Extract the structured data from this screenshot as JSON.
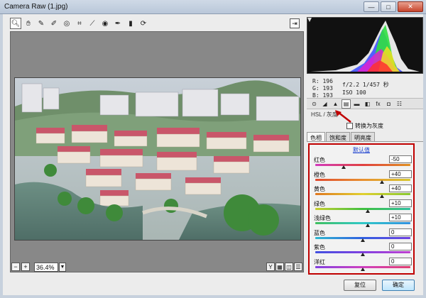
{
  "window": {
    "title": "Camera Raw (1.jpg)",
    "close_label": "✕",
    "min_label": "—",
    "max_label": "□"
  },
  "toolbar": {
    "tools": [
      "zoom-icon",
      "hand-icon",
      "eyedropper-icon",
      "color-sampler-icon",
      "target-adjust-icon",
      "crop-icon",
      "straighten-icon",
      "redeye-icon",
      "brush-icon",
      "filter-icon",
      "rotate-icon"
    ],
    "open_glyph": "⇥"
  },
  "zoom": {
    "minus": "−",
    "plus": "+",
    "value": "36.4%",
    "dropdown": "▼"
  },
  "view_icons": [
    "Y",
    "▦",
    "◫",
    "☰"
  ],
  "readout": {
    "r": "R:  196",
    "g": "G:  193",
    "b": "B:  193",
    "aperture": "f/2.2  1/457 秒",
    "iso": "ISO 100"
  },
  "panel_tabs": [
    "⊙",
    "◢",
    "▲",
    "▤",
    "▬",
    "◧",
    "fx",
    "◘",
    "☷"
  ],
  "section_label": "HSL / 灰度",
  "convert_gray": "转换为灰度",
  "subtabs": [
    "色相",
    "饱和度",
    "明亮度"
  ],
  "default_link": "默认值",
  "sliders": [
    {
      "label": "红色",
      "value": "-50",
      "pos": 0.3,
      "gradient": "linear-gradient(90deg,#d23cbe,#e04040,#e09020)"
    },
    {
      "label": "橙色",
      "value": "+40",
      "pos": 0.7,
      "gradient": "linear-gradient(90deg,#e04a30,#e89030,#d8c830)"
    },
    {
      "label": "黄色",
      "value": "+40",
      "pos": 0.7,
      "gradient": "linear-gradient(90deg,#e07820,#e0d030,#88c830)"
    },
    {
      "label": "绿色",
      "value": "+10",
      "pos": 0.55,
      "gradient": "linear-gradient(90deg,#c8d030,#40c040,#30c0a0)"
    },
    {
      "label": "浅绿色",
      "value": "+10",
      "pos": 0.55,
      "gradient": "linear-gradient(90deg,#40c060,#30c8c8,#3090e0)"
    },
    {
      "label": "蓝色",
      "value": "0",
      "pos": 0.5,
      "gradient": "linear-gradient(90deg,#30b8d0,#3060e0,#7040e0)"
    },
    {
      "label": "紫色",
      "value": "0",
      "pos": 0.5,
      "gradient": "linear-gradient(90deg,#4050e0,#8040e0,#c040d0)"
    },
    {
      "label": "洋红",
      "value": "0",
      "pos": 0.5,
      "gradient": "linear-gradient(90deg,#8040e0,#d040c0,#e04070)"
    }
  ],
  "buttons": {
    "reset": "复位",
    "ok": "确定"
  },
  "colors": {
    "annotation_red": "#c00000",
    "default_link": "#1a3fcf"
  }
}
